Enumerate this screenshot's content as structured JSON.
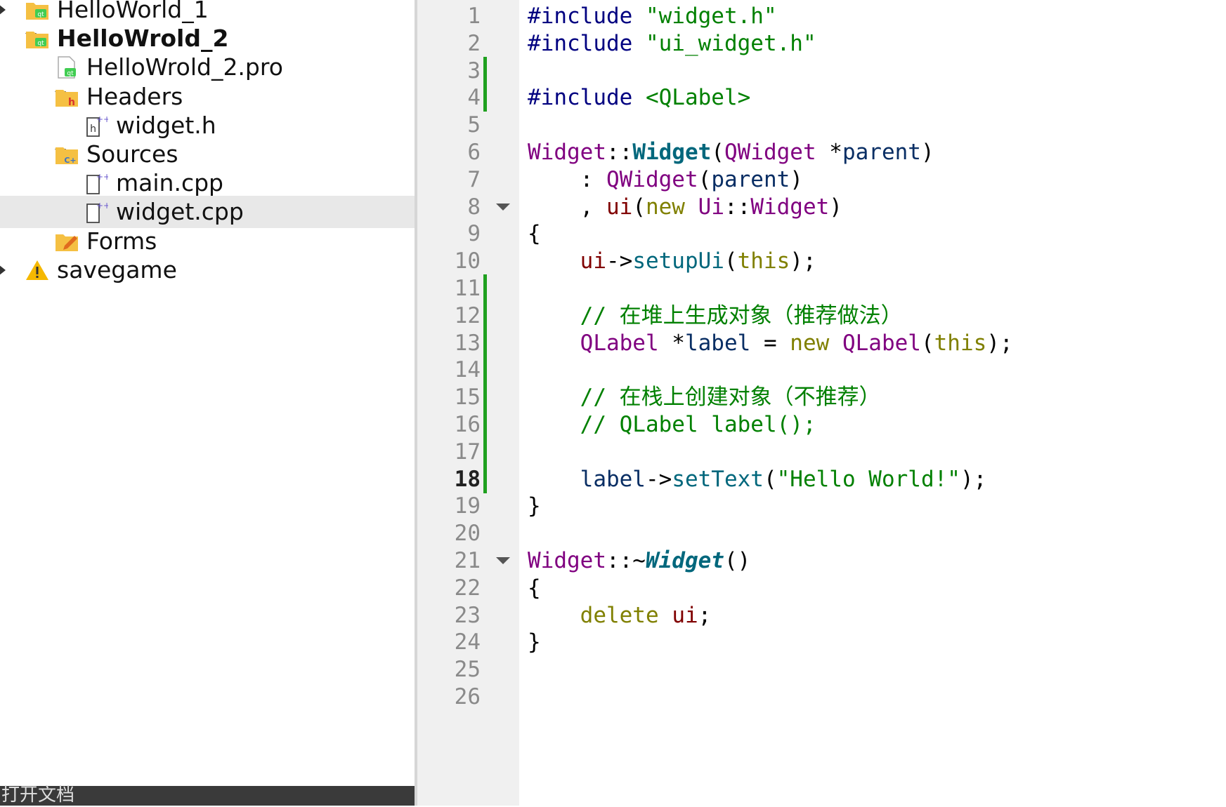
{
  "project_tree": {
    "items": [
      {
        "label": "HelloWorld_1",
        "icon": "qt-project-folder-icon",
        "arrow": "right",
        "bold": false
      },
      {
        "label": "HelloWrold_2",
        "icon": "qt-project-folder-icon",
        "arrow": "down",
        "bold": true
      },
      {
        "label": "HelloWrold_2.pro",
        "icon": "qt-pro-file-icon",
        "arrow": "",
        "bold": false
      },
      {
        "label": "Headers",
        "icon": "headers-folder-icon",
        "arrow": "down",
        "bold": false
      },
      {
        "label": "widget.h",
        "icon": "header-file-icon",
        "arrow": "",
        "bold": false
      },
      {
        "label": "Sources",
        "icon": "sources-folder-icon",
        "arrow": "down",
        "bold": false
      },
      {
        "label": "main.cpp",
        "icon": "cpp-file-icon",
        "arrow": "",
        "bold": false
      },
      {
        "label": "widget.cpp",
        "icon": "cpp-file-icon",
        "arrow": "",
        "bold": false,
        "selected": true
      },
      {
        "label": "Forms",
        "icon": "forms-folder-icon",
        "arrow": "right",
        "bold": false
      },
      {
        "label": "savegame",
        "icon": "warning-icon",
        "arrow": "right",
        "bold": false
      }
    ]
  },
  "bottom_bar": {
    "label": "打开文档"
  },
  "editor": {
    "current_line": 18,
    "changed_lines": [
      3,
      4,
      11,
      12,
      13,
      14,
      15,
      16,
      17,
      18
    ],
    "fold_lines": [
      8,
      21
    ],
    "lines": [
      [
        [
          "pp",
          "#include "
        ],
        [
          "str",
          "\"widget.h\""
        ]
      ],
      [
        [
          "pp",
          "#include "
        ],
        [
          "str",
          "\"ui_widget.h\""
        ]
      ],
      [],
      [
        [
          "pp",
          "#include "
        ],
        [
          "str",
          "<QLabel>"
        ]
      ],
      [],
      [
        [
          "ty",
          "Widget"
        ],
        [
          "op",
          "::"
        ],
        [
          "fnb",
          "Widget"
        ],
        [
          "op",
          "("
        ],
        [
          "ty",
          "QWidget"
        ],
        [
          "op",
          " *"
        ],
        [
          "pr",
          "parent"
        ],
        [
          "op",
          ")"
        ]
      ],
      [
        [
          "op",
          "    : "
        ],
        [
          "ty",
          "QWidget"
        ],
        [
          "op",
          "("
        ],
        [
          "pr",
          "parent"
        ],
        [
          "op",
          ")"
        ]
      ],
      [
        [
          "op",
          "    , "
        ],
        [
          "mem",
          "ui"
        ],
        [
          "op",
          "("
        ],
        [
          "kw",
          "new"
        ],
        [
          "op",
          " "
        ],
        [
          "ty",
          "Ui"
        ],
        [
          "op",
          "::"
        ],
        [
          "ty",
          "Widget"
        ],
        [
          "op",
          ")"
        ]
      ],
      [
        [
          "op",
          "{"
        ]
      ],
      [
        [
          "op",
          "    "
        ],
        [
          "mem",
          "ui"
        ],
        [
          "op",
          "->"
        ],
        [
          "fn",
          "setupUi"
        ],
        [
          "op",
          "("
        ],
        [
          "kw",
          "this"
        ],
        [
          "op",
          ");"
        ]
      ],
      [],
      [
        [
          "cm",
          "    // 在堆上生成对象（推荐做法）"
        ]
      ],
      [
        [
          "op",
          "    "
        ],
        [
          "ty",
          "QLabel"
        ],
        [
          "op",
          " *"
        ],
        [
          "pr",
          "label"
        ],
        [
          "op",
          " = "
        ],
        [
          "kw",
          "new"
        ],
        [
          "op",
          " "
        ],
        [
          "ty",
          "QLabel"
        ],
        [
          "op",
          "("
        ],
        [
          "kw",
          "this"
        ],
        [
          "op",
          ");"
        ]
      ],
      [],
      [
        [
          "cm",
          "    // 在栈上创建对象（不推荐）"
        ]
      ],
      [
        [
          "cm",
          "    // QLabel label();"
        ]
      ],
      [],
      [
        [
          "op",
          "    "
        ],
        [
          "pr",
          "label"
        ],
        [
          "op",
          "->"
        ],
        [
          "fn",
          "setText"
        ],
        [
          "op",
          "("
        ],
        [
          "str",
          "\"Hello World!\""
        ],
        [
          "op",
          ");"
        ]
      ],
      [
        [
          "op",
          "}"
        ]
      ],
      [],
      [
        [
          "ty",
          "Widget"
        ],
        [
          "op",
          "::~"
        ],
        [
          "fni",
          "Widget"
        ],
        [
          "op",
          "()"
        ]
      ],
      [
        [
          "op",
          "{"
        ]
      ],
      [
        [
          "op",
          "    "
        ],
        [
          "kw",
          "delete"
        ],
        [
          "op",
          " "
        ],
        [
          "mem",
          "ui"
        ],
        [
          "op",
          ";"
        ]
      ],
      [
        [
          "op",
          "}"
        ]
      ],
      [],
      []
    ]
  }
}
